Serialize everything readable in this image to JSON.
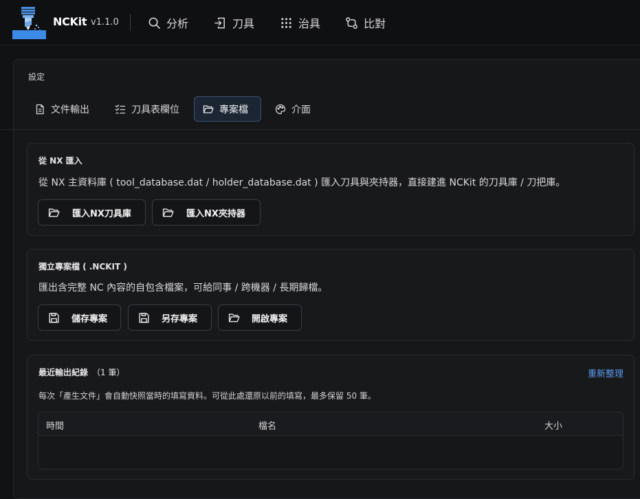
{
  "header": {
    "brand": "NCKit",
    "version": "v1.1.0",
    "nav": [
      {
        "label": "分析",
        "icon": "search-icon"
      },
      {
        "label": "刀具",
        "icon": "import-icon"
      },
      {
        "label": "治具",
        "icon": "grid-dots-icon"
      },
      {
        "label": "比對",
        "icon": "compare-icon"
      }
    ]
  },
  "settings": {
    "title": "設定",
    "tabs": [
      {
        "label": "文件輸出",
        "icon": "document-icon",
        "active": false
      },
      {
        "label": "刀具表欄位",
        "icon": "checklist-icon",
        "active": false
      },
      {
        "label": "專案檔",
        "icon": "folder-open-icon",
        "active": true
      },
      {
        "label": "介面",
        "icon": "palette-icon",
        "active": false
      }
    ]
  },
  "nx_import": {
    "title": "從 NX 匯入",
    "desc": "從 NX 主資料庫 ( tool_database.dat / holder_database.dat ) 匯入刀具與夾持器，直接建進 NCKit 的刀具庫 / 刀把庫。",
    "buttons": [
      "匯入NX刀具庫",
      "匯入NX夾持器"
    ]
  },
  "project_file": {
    "title": "獨立專案檔 ( .NCKIT )",
    "desc": "匯出含完整 NC 內容的自包含檔案，可給同事 / 跨機器 / 長期歸檔。",
    "buttons": [
      "儲存專案",
      "另存專案",
      "開啟專案"
    ]
  },
  "recent": {
    "title": "最近輸出紀錄",
    "count": "（1 筆）",
    "refresh": "重新整理",
    "desc": "每次「產生文件」會自動快照當時的填寫資料。可從此處還原以前的填寫，最多保留 50 筆。",
    "columns": [
      "時間",
      "檔名",
      "大小"
    ]
  },
  "colors": {
    "accent": "#5b9cf0",
    "active_tab_bg": "#1b2533",
    "active_tab_border": "#3b5475",
    "logo_blue": "#3d8be8"
  }
}
